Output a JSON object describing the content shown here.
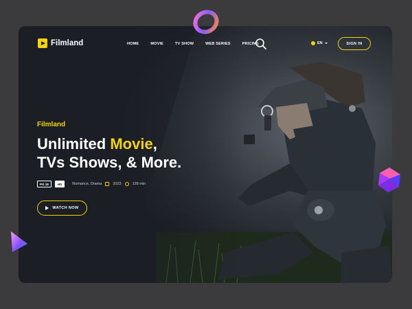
{
  "brand": {
    "name": "Filmland"
  },
  "nav": {
    "items": [
      {
        "label": "HOME"
      },
      {
        "label": "MOVIE"
      },
      {
        "label": "TV SHOW"
      },
      {
        "label": "WEB SERIES"
      },
      {
        "label": "PRICING"
      }
    ]
  },
  "header": {
    "search_icon": "search-icon",
    "language": "EN",
    "signin_label": "SIGN IN"
  },
  "hero": {
    "eyebrow": "Filmland",
    "headline_part1": "Unlimited ",
    "headline_highlight": "Movie",
    "headline_part2": ",",
    "headline_line2": "TVs Shows, & More.",
    "badge_rating": "PG 18",
    "badge_quality": "HD",
    "genres": "Romance, Drama",
    "year": "2023",
    "duration": "128 min",
    "watch_label": "WATCH NOW"
  },
  "colors": {
    "accent": "#f5d40f",
    "background": "#1b1e24",
    "outer": "#3b3b3e"
  }
}
